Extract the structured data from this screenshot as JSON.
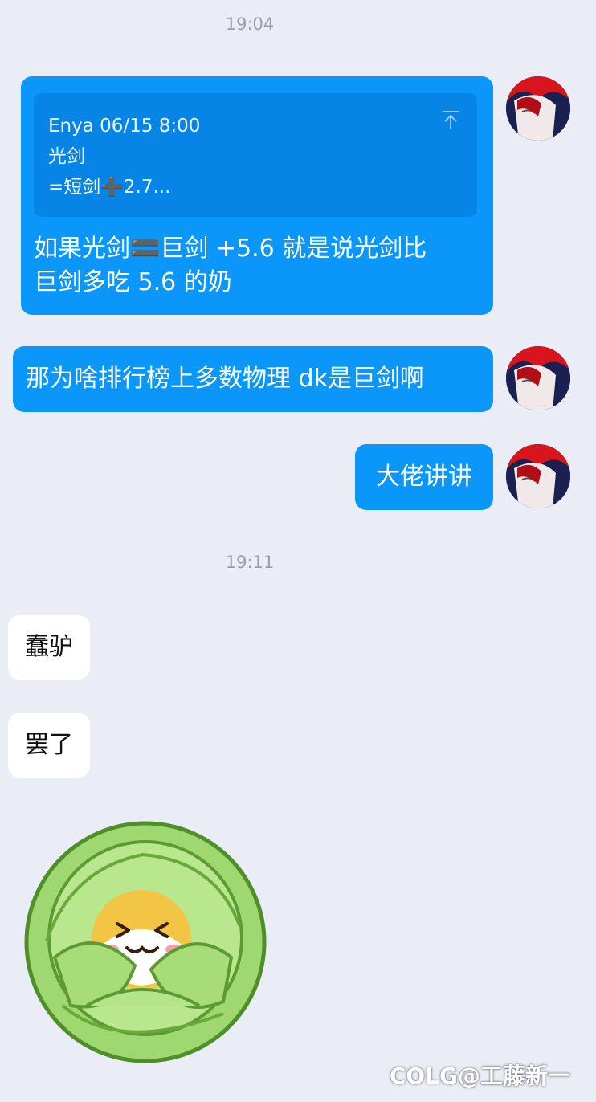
{
  "timestamps": [
    "19:04",
    "19:11"
  ],
  "messages": {
    "quote": {
      "header": "Enya 06/15 8:00",
      "line1": "光剑",
      "line2": "=短剑➕2.7..."
    },
    "reply_line1": "如果光剑🟰巨剑 +5.6  就是说光剑比",
    "reply_line2": "巨剑多吃 5.6 的奶",
    "question": "那为啥排行榜上多数物理 dk是巨剑啊",
    "ask": "大佬讲讲",
    "in1": "蠢驴",
    "in2": "罢了"
  },
  "watermark": "COLG@工藤新一",
  "colors": {
    "background": "#eaedf6",
    "outgoing_bubble": "#0b96fa",
    "quote_box": "#0785e6",
    "incoming_bubble": "#ffffff"
  },
  "icons": [
    "avatar",
    "pin-top-icon",
    "cabbage-shiba-sticker"
  ]
}
